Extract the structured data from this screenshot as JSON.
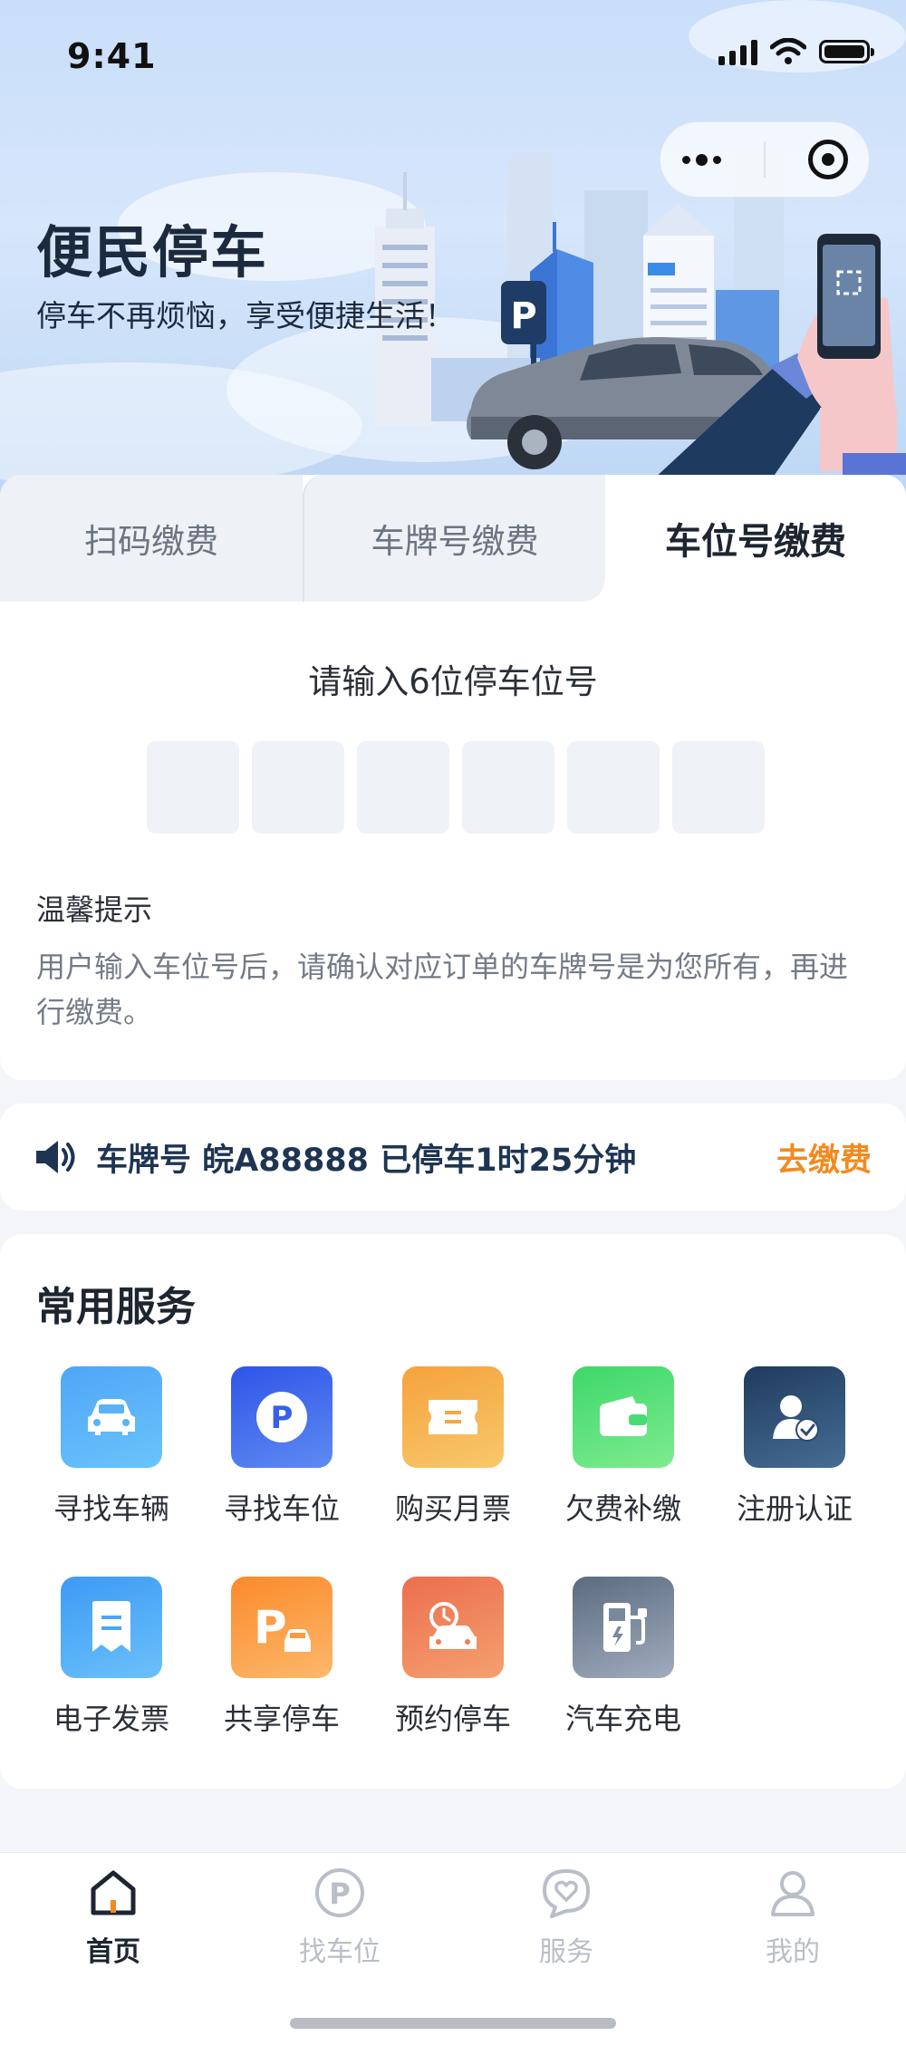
{
  "status_bar": {
    "time": "9:41"
  },
  "hero": {
    "title": "便民停车",
    "subtitle": "停车不再烦恼，享受便捷生活！"
  },
  "pay_tabs": [
    {
      "label": "扫码缴费",
      "active": false
    },
    {
      "label": "车牌号缴费",
      "active": false
    },
    {
      "label": "车位号缴费",
      "active": true
    }
  ],
  "space_input": {
    "label": "请输入6位停车位号",
    "digits": [
      "",
      "",
      "",
      "",
      "",
      ""
    ]
  },
  "tips": {
    "title": "温馨提示",
    "body": "用户输入车位号后，请确认对应订单的车牌号是为您所有，再进行缴费。"
  },
  "notice": {
    "text": "车牌号 皖A88888 已停车1时25分钟",
    "action": "去缴费",
    "action_color": "#f28a1e"
  },
  "services": {
    "title": "常用服务",
    "items": [
      {
        "label": "寻找车辆",
        "icon": "car-icon"
      },
      {
        "label": "寻找车位",
        "icon": "parking-p-icon"
      },
      {
        "label": "购买月票",
        "icon": "ticket-icon"
      },
      {
        "label": "欠费补缴",
        "icon": "wallet-icon"
      },
      {
        "label": "注册认证",
        "icon": "user-verify-icon"
      },
      {
        "label": "电子发票",
        "icon": "invoice-icon"
      },
      {
        "label": "共享停车",
        "icon": "shared-parking-icon"
      },
      {
        "label": "预约停车",
        "icon": "reserve-parking-icon"
      },
      {
        "label": "汽车充电",
        "icon": "ev-charger-icon"
      }
    ]
  },
  "tabbar": {
    "items": [
      {
        "label": "首页",
        "icon": "home-icon",
        "active": true
      },
      {
        "label": "找车位",
        "icon": "parking-circle-icon",
        "active": false
      },
      {
        "label": "服务",
        "icon": "heart-chat-icon",
        "active": false
      },
      {
        "label": "我的",
        "icon": "user-icon",
        "active": false
      }
    ]
  },
  "colors": {
    "accent": "#f28a1e",
    "text_primary": "#1d2530",
    "text_secondary": "#747b86",
    "inactive": "#b9bec7"
  }
}
